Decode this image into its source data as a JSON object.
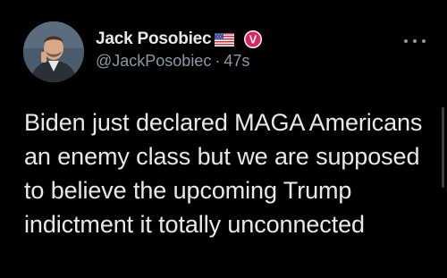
{
  "tweet": {
    "author": {
      "display_name": "Jack Posobiec",
      "handle": "@JackPosobiec",
      "separator": "·",
      "time": "47s",
      "flag": "us-flag-icon",
      "badge": {
        "icon": "verified-badge-icon",
        "letter": "V",
        "color": "#e0245e"
      }
    },
    "text": "Biden just declared MAGA Americans an enemy class but we are supposed to believe the upcoming Trump indictment it totally unconnected"
  },
  "more_menu": {
    "icon": "more-options-icon"
  },
  "colors": {
    "background": "#000000",
    "primary_text": "#e7e9ea",
    "secondary_text": "#8b98a5",
    "badge": "#e0245e"
  }
}
